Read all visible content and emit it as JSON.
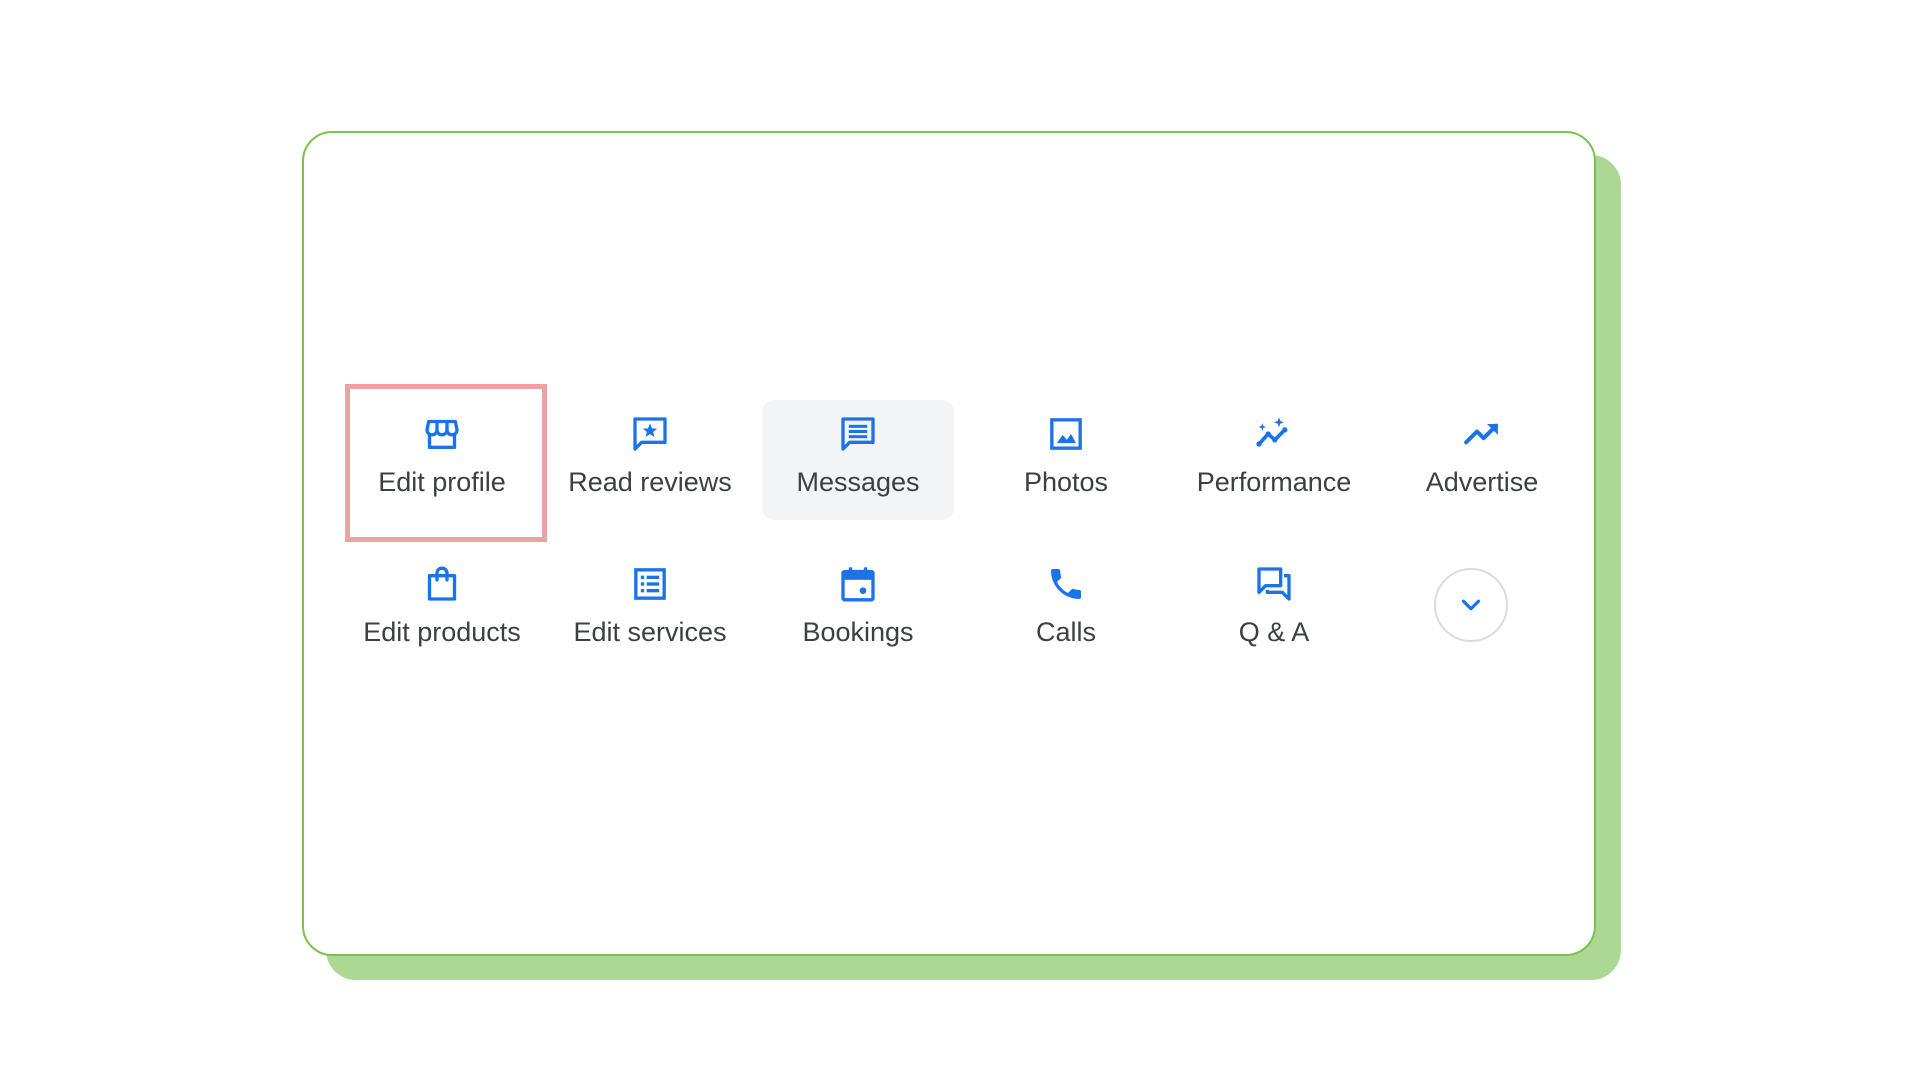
{
  "accent_color": "#1a73e8",
  "highlight_color": "#eea1a1",
  "card_border_color": "#79c34d",
  "card_shadow_color": "#acd794",
  "actions": {
    "row1": [
      {
        "label": "Edit profile",
        "icon": "storefront-icon"
      },
      {
        "label": "Read reviews",
        "icon": "review-star-icon"
      },
      {
        "label": "Messages",
        "icon": "message-icon"
      },
      {
        "label": "Photos",
        "icon": "photo-icon"
      },
      {
        "label": "Performance",
        "icon": "insights-icon"
      },
      {
        "label": "Advertise",
        "icon": "trending-up-icon"
      }
    ],
    "row2": [
      {
        "label": "Edit products",
        "icon": "shopping-bag-icon"
      },
      {
        "label": "Edit services",
        "icon": "list-icon"
      },
      {
        "label": "Bookings",
        "icon": "calendar-icon"
      },
      {
        "label": "Calls",
        "icon": "phone-icon"
      },
      {
        "label": "Q & A",
        "icon": "forum-icon"
      }
    ],
    "more_icon": "chevron-down-icon"
  }
}
